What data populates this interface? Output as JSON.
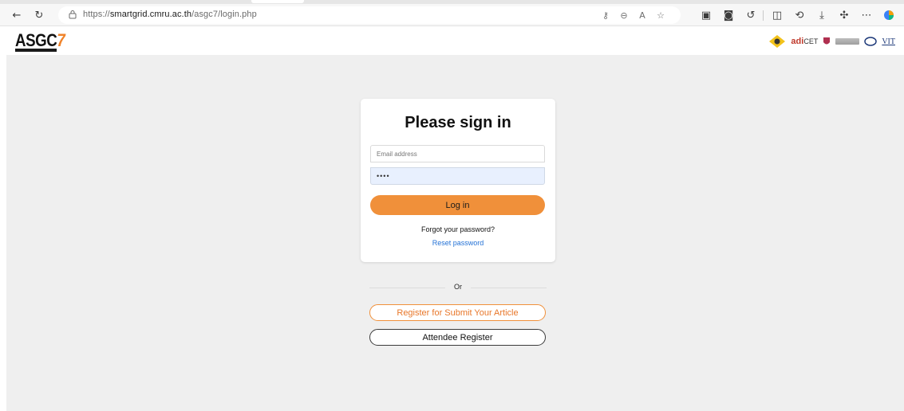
{
  "browser": {
    "url_prefix": "https://",
    "url_host": "smartgrid.cmru.ac.th",
    "url_path": "/asgc7/login.php",
    "icons": [
      "back-icon",
      "refresh-icon",
      "lock-icon",
      "key-icon",
      "zoom-icon",
      "read-aloud-icon",
      "favorite-star-icon",
      "screenshot-icon",
      "camera-icon",
      "copilot-icon",
      "split-screen-icon",
      "history-icon",
      "download-icon",
      "extension-icon",
      "more-icon",
      "edge-copilot-icon"
    ]
  },
  "header": {
    "logo_text": "ASGC",
    "logo_number": "7",
    "partner_adi": "adi",
    "partner_cet": "CET",
    "partner_vit": "VIT"
  },
  "login": {
    "title": "Please sign in",
    "email_placeholder": "Email address",
    "password_value": "••••",
    "login_label": "Log in",
    "forgot_text": "Forgot your password?",
    "reset_label": "Reset password"
  },
  "alt": {
    "or_text": "Or",
    "register_article_label": "Register for Submit Your Article",
    "attendee_label": "Attendee Register"
  },
  "colors": {
    "accent": "#f0903a",
    "link": "#2472d6",
    "page_bg": "#efefef"
  }
}
